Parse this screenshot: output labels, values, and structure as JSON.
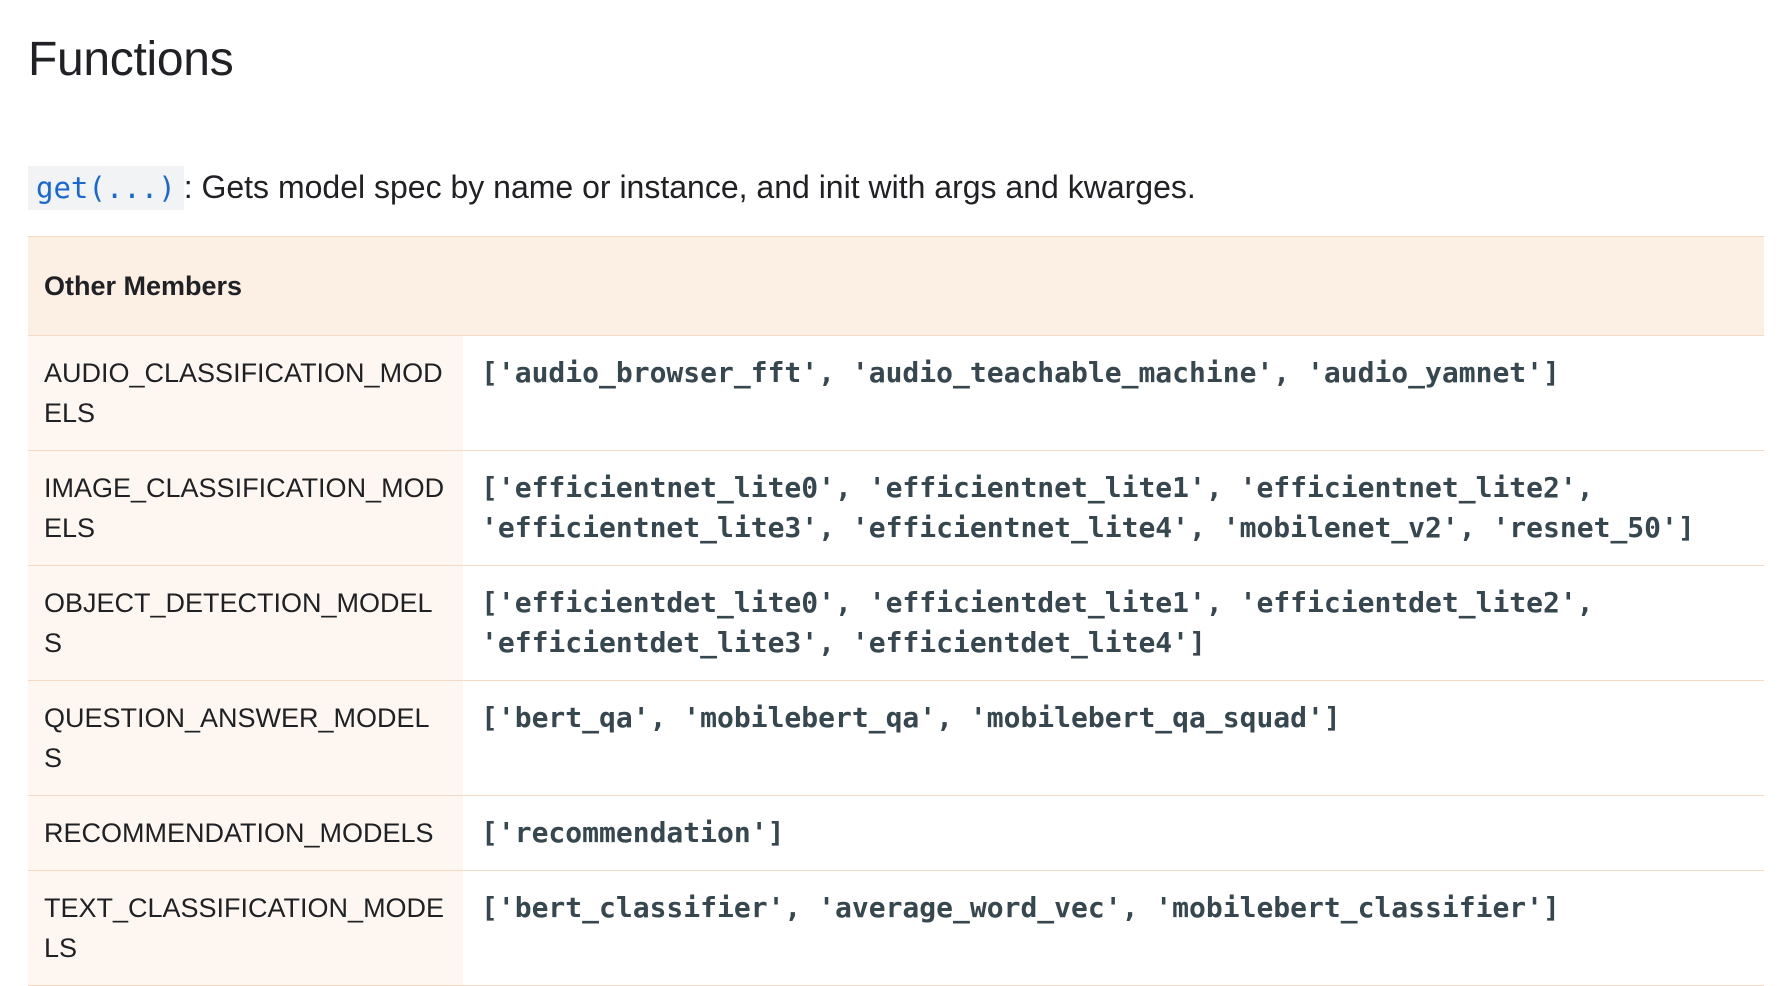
{
  "section": {
    "title": "Functions"
  },
  "function": {
    "link": "get(...)",
    "description": ": Gets model spec by name or instance, and init with args and kwarges."
  },
  "members_table": {
    "header": "Other Members",
    "rows": [
      {
        "name": "AUDIO_CLASSIFICATION_MODELS",
        "value": "['audio_browser_fft', 'audio_teachable_machine', 'audio_yamnet']"
      },
      {
        "name": "IMAGE_CLASSIFICATION_MODELS",
        "value": "['efficientnet_lite0', 'efficientnet_lite1', 'efficientnet_lite2', 'efficientnet_lite3', 'efficientnet_lite4', 'mobilenet_v2', 'resnet_50']"
      },
      {
        "name": "OBJECT_DETECTION_MODELS",
        "value": "['efficientdet_lite0', 'efficientdet_lite1', 'efficientdet_lite2', 'efficientdet_lite3', 'efficientdet_lite4']"
      },
      {
        "name": "QUESTION_ANSWER_MODELS",
        "value": "['bert_qa', 'mobilebert_qa', 'mobilebert_qa_squad']"
      },
      {
        "name": "RECOMMENDATION_MODELS",
        "value": "['recommendation']"
      },
      {
        "name": "TEXT_CLASSIFICATION_MODELS",
        "value": "['bert_classifier', 'average_word_vec', 'mobilebert_classifier']"
      }
    ]
  }
}
